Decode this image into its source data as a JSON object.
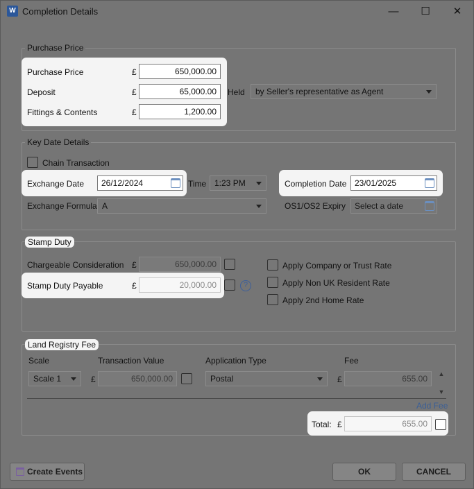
{
  "window": {
    "title": "Completion Details",
    "app_icon": "W"
  },
  "purchase": {
    "legend": "Purchase Price",
    "price_label": "Purchase Price",
    "price_value": "650,000.00",
    "deposit_label": "Deposit",
    "deposit_value": "65,000.00",
    "fittings_label": "Fittings & Contents",
    "fittings_value": "1,200.00",
    "held_label": "Held",
    "held_value": "by Seller's representative as Agent",
    "currency": "£"
  },
  "dates": {
    "legend": "Key Date Details",
    "chain_label": "Chain Transaction",
    "exchange_label": "Exchange Date",
    "exchange_value": "26/12/2024",
    "time_label": "Time",
    "time_value": "1:23 PM",
    "completion_label": "Completion Date",
    "completion_value": "23/01/2025",
    "formula_label": "Exchange Formula",
    "formula_value": "A",
    "os_label": "OS1/OS2 Expiry",
    "os_placeholder": "Select a date"
  },
  "stamp": {
    "legend": "Stamp Duty",
    "chargeable_label": "Chargeable Consideration",
    "chargeable_value": "650,000.00",
    "payable_label": "Stamp Duty Payable",
    "payable_value": "20,000.00",
    "help": "?",
    "opt_company": "Apply Company or Trust Rate",
    "opt_nonuk": "Apply Non UK Resident Rate",
    "opt_second": "Apply 2nd Home Rate"
  },
  "land": {
    "legend": "Land Registry Fee",
    "col_scale": "Scale",
    "col_value": "Transaction Value",
    "col_app": "Application Type",
    "col_fee": "Fee",
    "row_scale": "Scale 1",
    "row_value": "650,000.00",
    "row_app": "Postal",
    "row_fee": "655.00",
    "add_fee": "Add Fee",
    "total_label": "Total:",
    "total_value": "655.00"
  },
  "footer": {
    "create_events": "Create Events",
    "ok": "OK",
    "cancel": "CANCEL"
  },
  "icons": {
    "minimize": "—",
    "maximize": "☐",
    "close": "✕",
    "up": "▲",
    "down": "▼"
  }
}
